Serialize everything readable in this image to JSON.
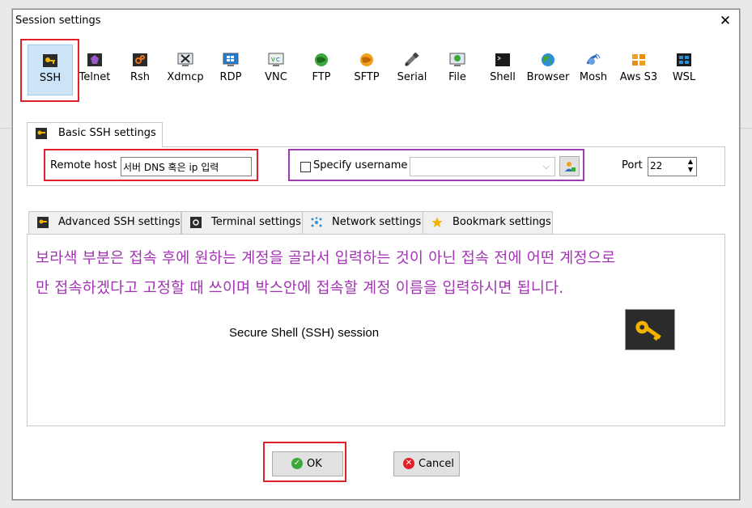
{
  "dialog": {
    "title": "Session settings",
    "close_glyph": "✕"
  },
  "session_types": [
    {
      "label": "SSH",
      "icon": "ssh-key-icon",
      "selected": true
    },
    {
      "label": "Telnet",
      "icon": "telnet-icon"
    },
    {
      "label": "Rsh",
      "icon": "rsh-icon"
    },
    {
      "label": "Xdmcp",
      "icon": "xdmcp-icon"
    },
    {
      "label": "RDP",
      "icon": "rdp-icon"
    },
    {
      "label": "VNC",
      "icon": "vnc-icon"
    },
    {
      "label": "FTP",
      "icon": "ftp-icon"
    },
    {
      "label": "SFTP",
      "icon": "sftp-icon"
    },
    {
      "label": "Serial",
      "icon": "serial-icon"
    },
    {
      "label": "File",
      "icon": "file-icon"
    },
    {
      "label": "Shell",
      "icon": "shell-icon"
    },
    {
      "label": "Browser",
      "icon": "browser-icon"
    },
    {
      "label": "Mosh",
      "icon": "mosh-icon"
    },
    {
      "label": "Aws S3",
      "icon": "aws-s3-icon"
    },
    {
      "label": "WSL",
      "icon": "wsl-icon"
    }
  ],
  "basic_tab": {
    "label": "Basic SSH settings"
  },
  "basic": {
    "remote_host_label": "Remote host *",
    "remote_host_value": "서버 DNS 혹은 ip 입력",
    "specify_username_label": "Specify username",
    "specify_username_checked": false,
    "username_value": "",
    "port_label": "Port",
    "port_value": "22"
  },
  "sub_tabs": [
    {
      "label": "Advanced SSH settings",
      "icon": "wrench-key-icon"
    },
    {
      "label": "Terminal settings",
      "icon": "terminal-settings-icon"
    },
    {
      "label": "Network settings",
      "icon": "network-icon"
    },
    {
      "label": "Bookmark settings",
      "icon": "star-icon"
    }
  ],
  "annotation": {
    "line1": "보라색 부분은 접속 후에 원하는 계정을 골라서 입력하는 것이 아닌 접속 전에 어떤 계정으로",
    "line2": "만 접속하겠다고 고정할 때 쓰이며 박스안에 접속할 계정 이름을 입력하시면 됩니다."
  },
  "session_description": "Secure Shell (SSH) session",
  "buttons": {
    "ok": "OK",
    "cancel": "Cancel"
  },
  "colors": {
    "highlight_red": "#e0202a",
    "highlight_purple": "#9b3fb0",
    "annotation_text": "#a234b4",
    "selection_bg": "#cce4f7"
  }
}
